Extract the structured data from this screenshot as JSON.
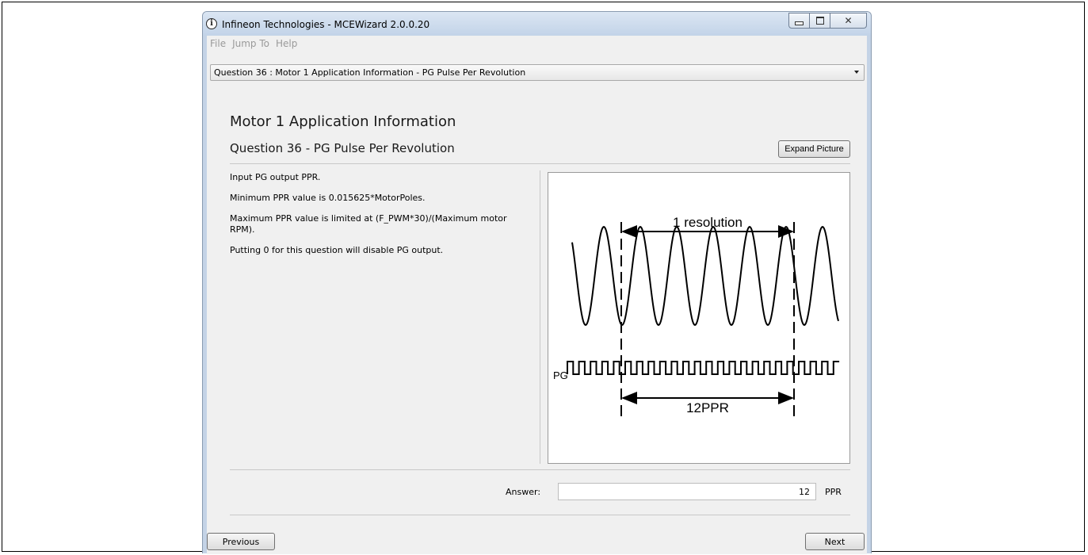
{
  "window": {
    "title": "Infineon Technologies - MCEWizard 2.0.0.20",
    "icon": "info-icon"
  },
  "menu": [
    "File",
    "Jump To",
    "Help"
  ],
  "question_select": {
    "selected": "Question  36 : Motor 1 Application Information - PG Pulse Per Revolution"
  },
  "section_title": "Motor 1 Application Information",
  "question_title": "Question 36 - PG Pulse Per Revolution",
  "expand_label": "Expand Picture",
  "description": [
    "Input PG output PPR.",
    "Minimum PPR value is 0.015625*MotorPoles.",
    "Maximum PPR value is limited at (F_PWM*30)/(Maximum motor RPM).",
    "Putting 0 for this question will disable PG output."
  ],
  "picture": {
    "resolution_label": "1 resolution",
    "pg_label": "PG",
    "ppr_label": "12PPR"
  },
  "answer": {
    "label": "Answer:",
    "value": "12",
    "unit": "PPR"
  },
  "buttons": {
    "previous": "Previous",
    "next": "Next"
  }
}
